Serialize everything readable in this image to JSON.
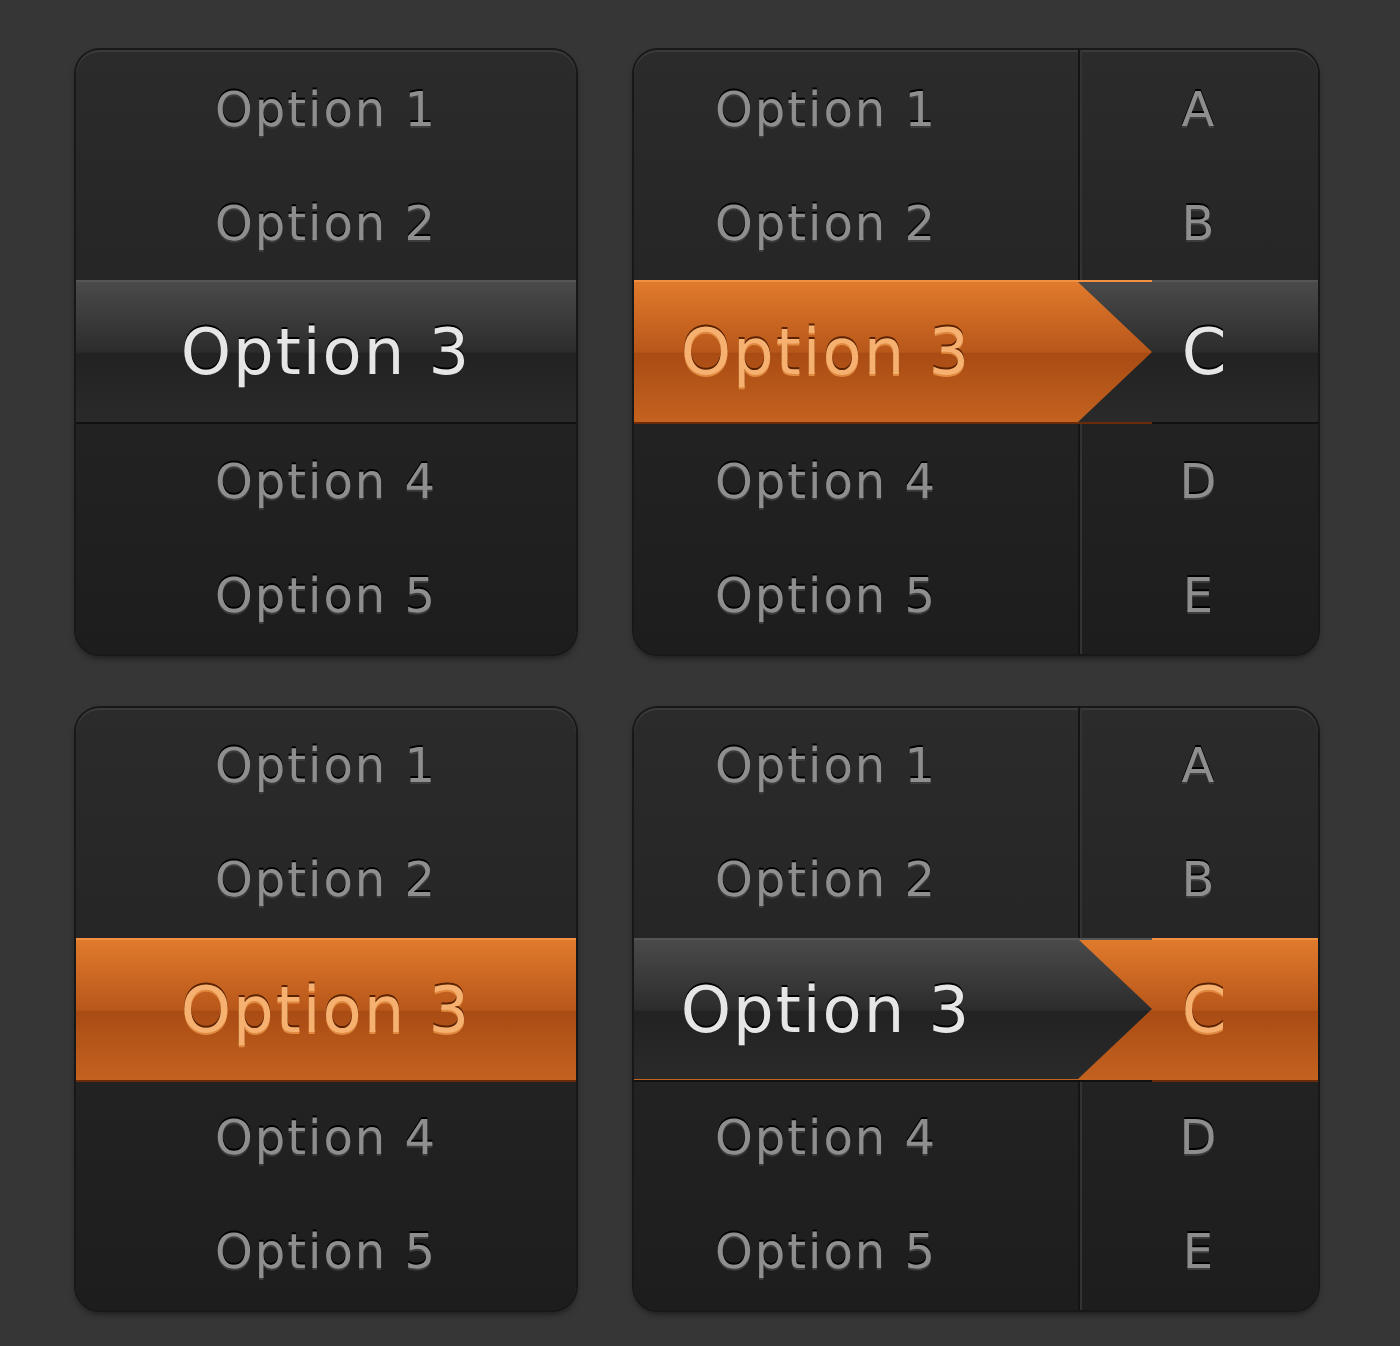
{
  "pickers": [
    {
      "columns": [
        {
          "accented": false,
          "items": [
            {
              "label": "Option 1",
              "selected": false
            },
            {
              "label": "Option 2",
              "selected": false
            },
            {
              "label": "Option 3",
              "selected": true
            },
            {
              "label": "Option 4",
              "selected": false
            },
            {
              "label": "Option 5",
              "selected": false
            }
          ]
        }
      ]
    },
    {
      "columns": [
        {
          "accented": true,
          "items": [
            {
              "label": "Option 1",
              "selected": false
            },
            {
              "label": "Option 2",
              "selected": false
            },
            {
              "label": "Option 3",
              "selected": true
            },
            {
              "label": "Option 4",
              "selected": false
            },
            {
              "label": "Option 5",
              "selected": false
            }
          ]
        },
        {
          "accented": false,
          "items": [
            {
              "label": "A",
              "selected": false
            },
            {
              "label": "B",
              "selected": false
            },
            {
              "label": "C",
              "selected": true
            },
            {
              "label": "D",
              "selected": false
            },
            {
              "label": "E",
              "selected": false
            }
          ]
        }
      ]
    },
    {
      "columns": [
        {
          "accented": true,
          "items": [
            {
              "label": "Option 1",
              "selected": false
            },
            {
              "label": "Option 2",
              "selected": false
            },
            {
              "label": "Option 3",
              "selected": true
            },
            {
              "label": "Option 4",
              "selected": false
            },
            {
              "label": "Option 5",
              "selected": false
            }
          ]
        }
      ]
    },
    {
      "columns": [
        {
          "accented": false,
          "items": [
            {
              "label": "Option 1",
              "selected": false
            },
            {
              "label": "Option 2",
              "selected": false
            },
            {
              "label": "Option 3",
              "selected": true
            },
            {
              "label": "Option 4",
              "selected": false
            },
            {
              "label": "Option 5",
              "selected": false
            }
          ]
        },
        {
          "accented": true,
          "items": [
            {
              "label": "A",
              "selected": false
            },
            {
              "label": "B",
              "selected": false
            },
            {
              "label": "C",
              "selected": true
            },
            {
              "label": "D",
              "selected": false
            },
            {
              "label": "E",
              "selected": false
            }
          ]
        }
      ]
    }
  ]
}
